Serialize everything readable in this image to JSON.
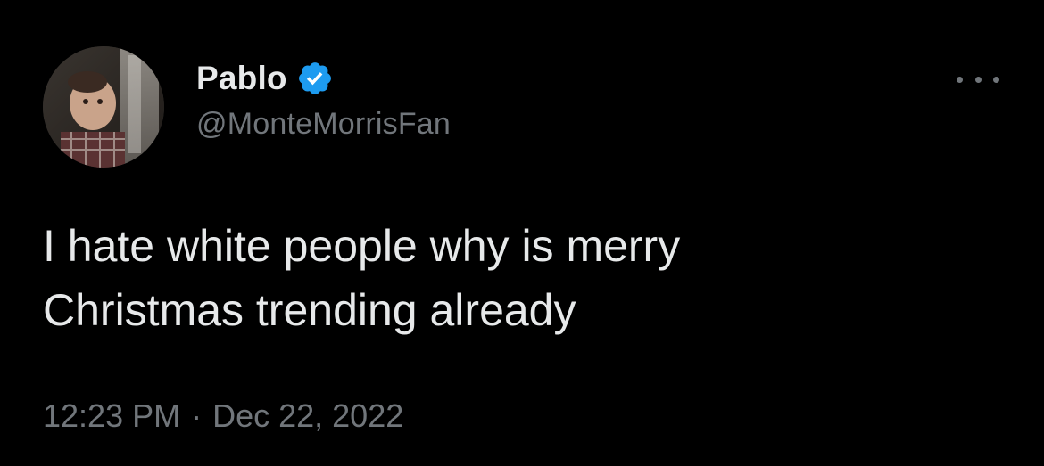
{
  "author": {
    "display_name": "Pablo",
    "handle": "@MonteMorrisFan",
    "verified": true,
    "avatar_icon": "profile-photo-icon"
  },
  "tweet": {
    "text": "I hate white people why is merry\nChristmas trending already",
    "time": "12:23 PM",
    "separator": "·",
    "date": "Dec 22, 2022"
  },
  "menu": {
    "icon": "more-options-icon"
  },
  "colors": {
    "background": "#000000",
    "primary_text": "#e7e9ea",
    "secondary_text": "#71767b",
    "verified_blue": "#1d9bf0"
  }
}
